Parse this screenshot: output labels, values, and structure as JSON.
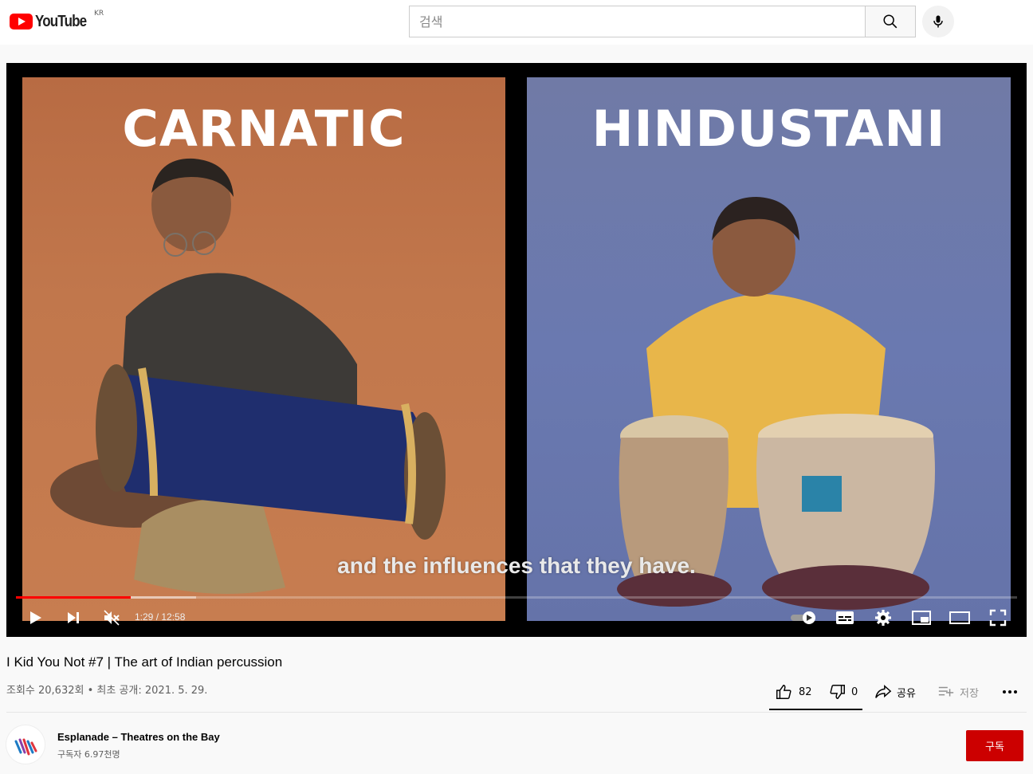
{
  "header": {
    "logo_text": "YouTube",
    "country_code": "KR",
    "search_placeholder": "검색"
  },
  "video": {
    "panels": [
      {
        "title": "CARNATIC",
        "bg": "#c1774c"
      },
      {
        "title": "HINDUSTANI",
        "bg": "#6a79b0"
      }
    ],
    "caption": "and the influences that they have.",
    "time": "1:29 / 12:58",
    "progress_fraction": 0.115,
    "buffered_fraction": 0.18,
    "progress_color": "#ff0000"
  },
  "info": {
    "title": "I Kid You Not #7 | The art of Indian percussion",
    "meta": "조회수 20,632회 • 최초 공개: 2021. 5. 29.",
    "likes": "82",
    "dislikes": "0",
    "share_label": "공유",
    "save_label": "저장"
  },
  "channel": {
    "name": "Esplanade – Theatres on the Bay",
    "subscribers": "구독자 6.97천명",
    "subscribe_label": "구독",
    "subscribe_color": "#cc0000"
  },
  "icons": [
    "youtube-logo-icon",
    "search-icon",
    "mic-icon",
    "play-icon",
    "next-icon",
    "mute-icon",
    "autoplay-toggle-icon",
    "subtitles-icon",
    "settings-icon",
    "miniplayer-icon",
    "theater-icon",
    "fullscreen-icon",
    "like-icon",
    "dislike-icon",
    "share-icon",
    "save-icon",
    "more-icon"
  ]
}
